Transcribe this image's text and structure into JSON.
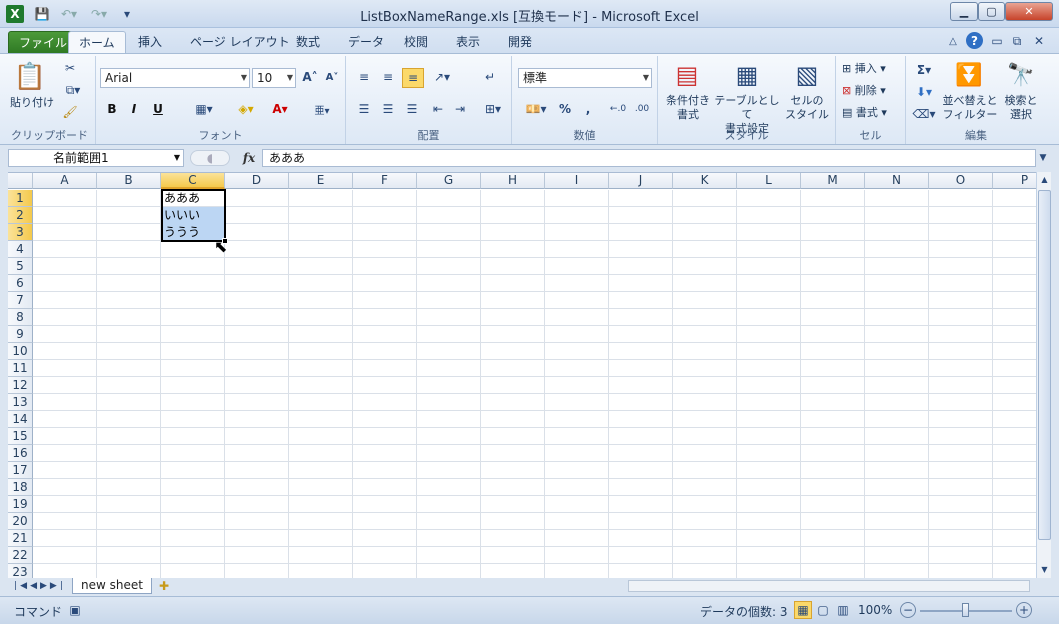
{
  "window": {
    "title": "ListBoxNameRange.xls [互換モード] - Microsoft Excel"
  },
  "tabs": [
    "ファイル",
    "ホーム",
    "挿入",
    "ページ レイアウト",
    "数式",
    "データ",
    "校閲",
    "表示",
    "開発"
  ],
  "ribbon": {
    "clipboard": {
      "paste": "貼り付け",
      "label": "クリップボード"
    },
    "font": {
      "name": "Arial",
      "size": "10",
      "label": "フォント",
      "bold": "B",
      "italic": "I",
      "underline": "U"
    },
    "alignment": {
      "label": "配置"
    },
    "number": {
      "format": "標準",
      "percent": "%",
      "comma": ",",
      "label": "数値"
    },
    "styles": {
      "conditional": "条件付き\n書式",
      "table": "テーブルとして\n書式設定",
      "cell": "セルの\nスタイル",
      "label": "スタイル"
    },
    "cells": {
      "insert": "挿入",
      "delete": "削除",
      "format": "書式",
      "label": "セル"
    },
    "editing": {
      "sort": "並べ替えと\nフィルター",
      "find": "検索と\n選択",
      "label": "編集"
    }
  },
  "formula_bar": {
    "name_box": "名前範囲1",
    "fx": "fx",
    "content": "あああ"
  },
  "columns": [
    "A",
    "B",
    "C",
    "D",
    "E",
    "F",
    "G",
    "H",
    "I",
    "J",
    "K",
    "L",
    "M",
    "N",
    "O",
    "P"
  ],
  "rows": [
    "1",
    "2",
    "3",
    "4",
    "5",
    "6",
    "7",
    "8",
    "9",
    "10",
    "11",
    "12",
    "13",
    "14",
    "15",
    "16",
    "17",
    "18",
    "19",
    "20",
    "21",
    "22",
    "23"
  ],
  "cells": {
    "C1": "あああ",
    "C2": "いいい",
    "C3": "ううう"
  },
  "sheet_tabs": [
    "new sheet"
  ],
  "status": {
    "mode": "コマンド",
    "count": "データの個数: 3",
    "zoom": "100%"
  }
}
